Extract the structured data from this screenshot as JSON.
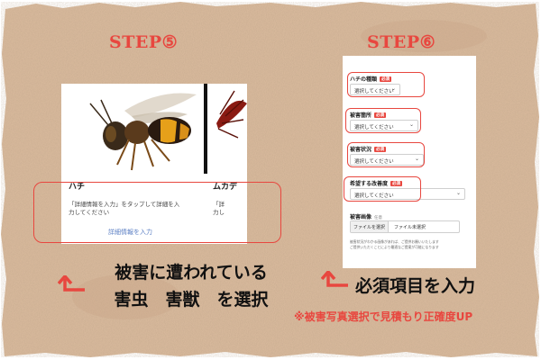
{
  "step5": {
    "title": "STEP⑤",
    "card": {
      "name": "ハチ",
      "name_next": "ムカデ",
      "description_line1": "「詳細情報を入力」をタップして詳細を入",
      "description_line2": "力してください",
      "description_next1": "「詳",
      "description_next2": "力し",
      "detail_link": "詳細情報を入力"
    },
    "caption_line1": "被害に遭われている",
    "caption_line2": "害虫　害獣　を選択"
  },
  "step6": {
    "title": "STEP⑥",
    "form": {
      "fields": [
        {
          "label": "ハチの種類",
          "badge": "必須",
          "placeholder": "選択してください"
        },
        {
          "label": "被害箇所",
          "badge": "必須",
          "placeholder": "選択してください"
        },
        {
          "label": "被害状況",
          "badge": "必須",
          "placeholder": "選択してください"
        },
        {
          "label": "希望する改善度",
          "badge": "必須",
          "placeholder": "選択してください"
        }
      ],
      "image_label": "被害画像",
      "image_badge": "任意",
      "file_button": "ファイルを選択",
      "file_status": "ファイル未選択",
      "help_line1": "被害状況がわかる画像があれば、ご提供お願いいたします",
      "help_line2": "ご提供いただくことにより最適なご提案が可能になります"
    },
    "caption": "必須項目を入力",
    "note": "※被害写真選択で見積もり正確度UP"
  },
  "colors": {
    "accent": "#e8473f",
    "paper": "#d8b99c",
    "text": "#111111"
  },
  "icons": [
    "return-arrow-icon",
    "chevron-down-icon",
    "wasp-image",
    "centipede-image"
  ]
}
